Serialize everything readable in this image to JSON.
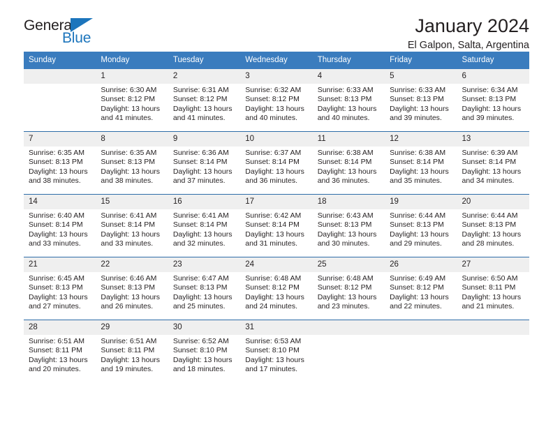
{
  "brand": {
    "name_part1": "General",
    "name_part2": "Blue"
  },
  "header": {
    "title": "January 2024",
    "subtitle": "El Galpon, Salta, Argentina"
  },
  "colors": {
    "header_blue": "#3a7cbe",
    "divider_blue": "#2d6ca8",
    "daynum_band": "#efefef",
    "brand_blue": "#1c75bc",
    "text": "#231f20"
  },
  "weekdays": [
    "Sunday",
    "Monday",
    "Tuesday",
    "Wednesday",
    "Thursday",
    "Friday",
    "Saturday"
  ],
  "weeks": [
    [
      {
        "day": "",
        "sunrise": "",
        "sunset": "",
        "daylight1": "",
        "daylight2": ""
      },
      {
        "day": "1",
        "sunrise": "Sunrise: 6:30 AM",
        "sunset": "Sunset: 8:12 PM",
        "daylight1": "Daylight: 13 hours",
        "daylight2": "and 41 minutes."
      },
      {
        "day": "2",
        "sunrise": "Sunrise: 6:31 AM",
        "sunset": "Sunset: 8:12 PM",
        "daylight1": "Daylight: 13 hours",
        "daylight2": "and 41 minutes."
      },
      {
        "day": "3",
        "sunrise": "Sunrise: 6:32 AM",
        "sunset": "Sunset: 8:12 PM",
        "daylight1": "Daylight: 13 hours",
        "daylight2": "and 40 minutes."
      },
      {
        "day": "4",
        "sunrise": "Sunrise: 6:33 AM",
        "sunset": "Sunset: 8:13 PM",
        "daylight1": "Daylight: 13 hours",
        "daylight2": "and 40 minutes."
      },
      {
        "day": "5",
        "sunrise": "Sunrise: 6:33 AM",
        "sunset": "Sunset: 8:13 PM",
        "daylight1": "Daylight: 13 hours",
        "daylight2": "and 39 minutes."
      },
      {
        "day": "6",
        "sunrise": "Sunrise: 6:34 AM",
        "sunset": "Sunset: 8:13 PM",
        "daylight1": "Daylight: 13 hours",
        "daylight2": "and 39 minutes."
      }
    ],
    [
      {
        "day": "7",
        "sunrise": "Sunrise: 6:35 AM",
        "sunset": "Sunset: 8:13 PM",
        "daylight1": "Daylight: 13 hours",
        "daylight2": "and 38 minutes."
      },
      {
        "day": "8",
        "sunrise": "Sunrise: 6:35 AM",
        "sunset": "Sunset: 8:13 PM",
        "daylight1": "Daylight: 13 hours",
        "daylight2": "and 38 minutes."
      },
      {
        "day": "9",
        "sunrise": "Sunrise: 6:36 AM",
        "sunset": "Sunset: 8:14 PM",
        "daylight1": "Daylight: 13 hours",
        "daylight2": "and 37 minutes."
      },
      {
        "day": "10",
        "sunrise": "Sunrise: 6:37 AM",
        "sunset": "Sunset: 8:14 PM",
        "daylight1": "Daylight: 13 hours",
        "daylight2": "and 36 minutes."
      },
      {
        "day": "11",
        "sunrise": "Sunrise: 6:38 AM",
        "sunset": "Sunset: 8:14 PM",
        "daylight1": "Daylight: 13 hours",
        "daylight2": "and 36 minutes."
      },
      {
        "day": "12",
        "sunrise": "Sunrise: 6:38 AM",
        "sunset": "Sunset: 8:14 PM",
        "daylight1": "Daylight: 13 hours",
        "daylight2": "and 35 minutes."
      },
      {
        "day": "13",
        "sunrise": "Sunrise: 6:39 AM",
        "sunset": "Sunset: 8:14 PM",
        "daylight1": "Daylight: 13 hours",
        "daylight2": "and 34 minutes."
      }
    ],
    [
      {
        "day": "14",
        "sunrise": "Sunrise: 6:40 AM",
        "sunset": "Sunset: 8:14 PM",
        "daylight1": "Daylight: 13 hours",
        "daylight2": "and 33 minutes."
      },
      {
        "day": "15",
        "sunrise": "Sunrise: 6:41 AM",
        "sunset": "Sunset: 8:14 PM",
        "daylight1": "Daylight: 13 hours",
        "daylight2": "and 33 minutes."
      },
      {
        "day": "16",
        "sunrise": "Sunrise: 6:41 AM",
        "sunset": "Sunset: 8:14 PM",
        "daylight1": "Daylight: 13 hours",
        "daylight2": "and 32 minutes."
      },
      {
        "day": "17",
        "sunrise": "Sunrise: 6:42 AM",
        "sunset": "Sunset: 8:14 PM",
        "daylight1": "Daylight: 13 hours",
        "daylight2": "and 31 minutes."
      },
      {
        "day": "18",
        "sunrise": "Sunrise: 6:43 AM",
        "sunset": "Sunset: 8:13 PM",
        "daylight1": "Daylight: 13 hours",
        "daylight2": "and 30 minutes."
      },
      {
        "day": "19",
        "sunrise": "Sunrise: 6:44 AM",
        "sunset": "Sunset: 8:13 PM",
        "daylight1": "Daylight: 13 hours",
        "daylight2": "and 29 minutes."
      },
      {
        "day": "20",
        "sunrise": "Sunrise: 6:44 AM",
        "sunset": "Sunset: 8:13 PM",
        "daylight1": "Daylight: 13 hours",
        "daylight2": "and 28 minutes."
      }
    ],
    [
      {
        "day": "21",
        "sunrise": "Sunrise: 6:45 AM",
        "sunset": "Sunset: 8:13 PM",
        "daylight1": "Daylight: 13 hours",
        "daylight2": "and 27 minutes."
      },
      {
        "day": "22",
        "sunrise": "Sunrise: 6:46 AM",
        "sunset": "Sunset: 8:13 PM",
        "daylight1": "Daylight: 13 hours",
        "daylight2": "and 26 minutes."
      },
      {
        "day": "23",
        "sunrise": "Sunrise: 6:47 AM",
        "sunset": "Sunset: 8:13 PM",
        "daylight1": "Daylight: 13 hours",
        "daylight2": "and 25 minutes."
      },
      {
        "day": "24",
        "sunrise": "Sunrise: 6:48 AM",
        "sunset": "Sunset: 8:12 PM",
        "daylight1": "Daylight: 13 hours",
        "daylight2": "and 24 minutes."
      },
      {
        "day": "25",
        "sunrise": "Sunrise: 6:48 AM",
        "sunset": "Sunset: 8:12 PM",
        "daylight1": "Daylight: 13 hours",
        "daylight2": "and 23 minutes."
      },
      {
        "day": "26",
        "sunrise": "Sunrise: 6:49 AM",
        "sunset": "Sunset: 8:12 PM",
        "daylight1": "Daylight: 13 hours",
        "daylight2": "and 22 minutes."
      },
      {
        "day": "27",
        "sunrise": "Sunrise: 6:50 AM",
        "sunset": "Sunset: 8:11 PM",
        "daylight1": "Daylight: 13 hours",
        "daylight2": "and 21 minutes."
      }
    ],
    [
      {
        "day": "28",
        "sunrise": "Sunrise: 6:51 AM",
        "sunset": "Sunset: 8:11 PM",
        "daylight1": "Daylight: 13 hours",
        "daylight2": "and 20 minutes."
      },
      {
        "day": "29",
        "sunrise": "Sunrise: 6:51 AM",
        "sunset": "Sunset: 8:11 PM",
        "daylight1": "Daylight: 13 hours",
        "daylight2": "and 19 minutes."
      },
      {
        "day": "30",
        "sunrise": "Sunrise: 6:52 AM",
        "sunset": "Sunset: 8:10 PM",
        "daylight1": "Daylight: 13 hours",
        "daylight2": "and 18 minutes."
      },
      {
        "day": "31",
        "sunrise": "Sunrise: 6:53 AM",
        "sunset": "Sunset: 8:10 PM",
        "daylight1": "Daylight: 13 hours",
        "daylight2": "and 17 minutes."
      },
      {
        "day": "",
        "sunrise": "",
        "sunset": "",
        "daylight1": "",
        "daylight2": ""
      },
      {
        "day": "",
        "sunrise": "",
        "sunset": "",
        "daylight1": "",
        "daylight2": ""
      },
      {
        "day": "",
        "sunrise": "",
        "sunset": "",
        "daylight1": "",
        "daylight2": ""
      }
    ]
  ]
}
